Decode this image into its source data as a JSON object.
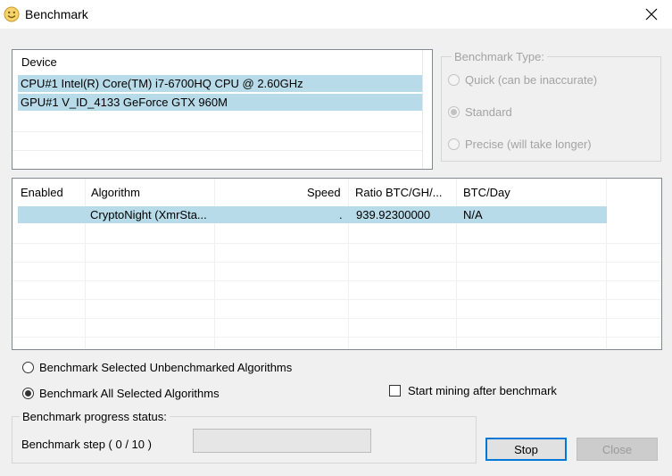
{
  "window": {
    "title": "Benchmark"
  },
  "device_list": {
    "header": "Device",
    "items": [
      "CPU#1 Intel(R) Core(TM) i7-6700HQ CPU @ 2.60GHz",
      "GPU#1 V_ID_4133 GeForce GTX 960M"
    ]
  },
  "benchmark_type": {
    "legend": "Benchmark Type:",
    "options": [
      {
        "label": "Quick (can be inaccurate)",
        "selected": false
      },
      {
        "label": "Standard",
        "selected": true
      },
      {
        "label": "Precise (will take longer)",
        "selected": false
      }
    ]
  },
  "algorithms": {
    "columns": [
      "Enabled",
      "Algorithm",
      "Speed",
      "Ratio BTC/GH/...",
      "BTC/Day"
    ],
    "rows": [
      {
        "enabled": "",
        "algorithm": "CryptoNight (XmrSta...",
        "speed": ".",
        "ratio": "939.92300000",
        "btc_day": "N/A"
      }
    ]
  },
  "mode_options": [
    {
      "label": "Benchmark Selected Unbenchmarked Algorithms",
      "selected": false
    },
    {
      "label": "Benchmark All Selected Algorithms",
      "selected": true
    }
  ],
  "start_mining": {
    "label": "Start mining after benchmark",
    "checked": false
  },
  "progress": {
    "legend": "Benchmark progress status:",
    "step_label": "Benchmark step ( 0 / 10 )"
  },
  "buttons": {
    "stop": "Stop",
    "close": "Close"
  },
  "colors": {
    "selection": "#b7dbe9",
    "focus_border": "#0078d7",
    "window_bg": "#f0f0f0",
    "disabled_text": "#a3a3a3"
  }
}
